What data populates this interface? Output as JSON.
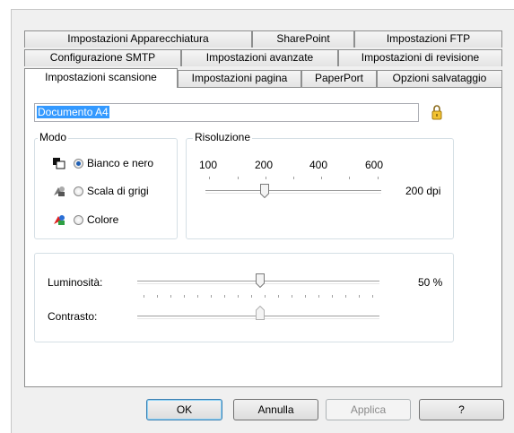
{
  "tabs": {
    "row1": [
      {
        "label": "Impostazioni Apparecchiatura"
      },
      {
        "label": "SharePoint"
      },
      {
        "label": "Impostazioni FTP"
      }
    ],
    "row2": [
      {
        "label": "Configurazione SMTP"
      },
      {
        "label": "Impostazioni avanzate"
      },
      {
        "label": "Impostazioni di revisione"
      }
    ],
    "row3": [
      {
        "label": "Impostazioni scansione"
      },
      {
        "label": "Impostazioni pagina"
      },
      {
        "label": "PaperPort"
      },
      {
        "label": "Opzioni salvataggio"
      }
    ],
    "active": "Impostazioni scansione"
  },
  "profile": {
    "name": "Documento A4",
    "lock_icon": "lock-icon"
  },
  "mode": {
    "title": "Modo",
    "options": [
      {
        "label": "Bianco e nero",
        "icon": "bw-mode-icon",
        "selected": true
      },
      {
        "label": "Scala di grigi",
        "icon": "grayscale-mode-icon",
        "selected": false
      },
      {
        "label": "Colore",
        "icon": "color-mode-icon",
        "selected": false
      }
    ]
  },
  "resolution": {
    "title": "Risoluzione",
    "ticks": [
      "100",
      "200",
      "400",
      "600"
    ],
    "value_label": "200 dpi",
    "value": 200
  },
  "brightness": {
    "label": "Luminosità:",
    "value_label": "50 %",
    "value": 50
  },
  "contrast": {
    "label": "Contrasto:",
    "value": 50
  },
  "buttons": {
    "ok": "OK",
    "cancel": "Annulla",
    "apply": "Applica",
    "help": "?"
  },
  "colors": {
    "accent": "#3399ff",
    "panel_border": "#8e8f8f"
  }
}
